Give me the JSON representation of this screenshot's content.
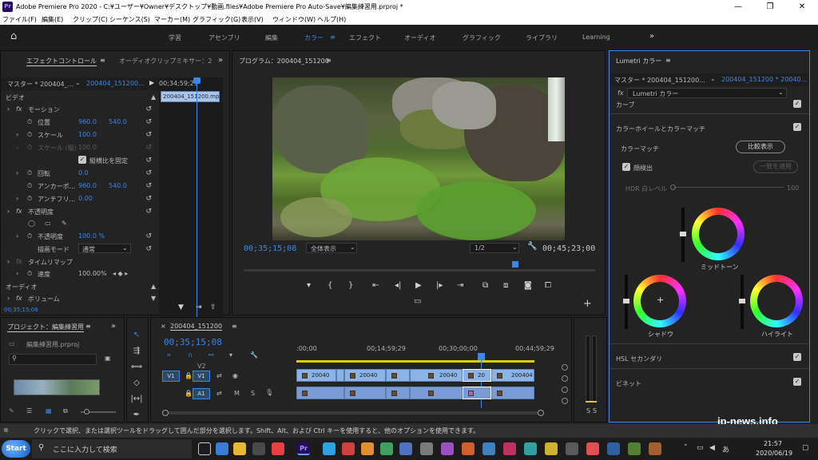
{
  "window": {
    "title": "Adobe Premiere Pro 2020 - C:¥ユーザー¥Owner¥デスクトップ¥動画.files¥Adobe Premiere Pro Auto-Save¥編集練習用.prproj *",
    "logo": "Pr",
    "minimize_icon": "minimize-icon",
    "restore_icon": "restore-icon",
    "close_icon": "close-icon"
  },
  "menu": [
    "ファイル(F)",
    "編集(E)",
    "クリップ(C)",
    "シーケンス(S)",
    "マーカー(M)",
    "グラフィック(G)",
    "表示(V)",
    "ウィンドウ(W)",
    "ヘルプ(H)"
  ],
  "workspaces": {
    "items": [
      "学習",
      "アセンブリ",
      "編集",
      "カラー",
      "エフェクト",
      "オーディオ",
      "グラフィック",
      "ライブラリ",
      "Learning"
    ],
    "active": "カラー",
    "more": "»"
  },
  "effect_controls": {
    "tab": "エフェクトコントロール",
    "tab_menu": "≡",
    "tab2": "オーディオクリップミキサー：2",
    "more": "»",
    "master": "マスター * 200404_...",
    "clip": "200404_151200...",
    "mini_timecode": "00;34;59;29",
    "mini_clip": "200404_151200.mp",
    "section_video": "ビデオ",
    "motion": "モーション",
    "position_label": "位置",
    "position_x": "960.0",
    "position_y": "540.0",
    "scale_label": "スケール",
    "scale_value": "100.0",
    "scale_w_label": "スケール (幅)",
    "scale_w_value": "100.0",
    "uniform_scale": "縦横比を固定",
    "rotation_label": "回転",
    "rotation_value": "0.0",
    "anchor_label": "アンカーポ...",
    "anchor_x": "960.0",
    "anchor_y": "540.0",
    "antiflicker_label": "アンチフリ...",
    "antiflicker_value": "0.00",
    "opacity": "不透明度",
    "opacity_label": "不透明度",
    "opacity_value": "100.0 %",
    "blend_label": "描画モード",
    "blend_value": "通常",
    "time_remap": "タイムリマップ",
    "speed_label": "速度",
    "speed_value": "100.00%",
    "section_audio": "オーディオ",
    "volume": "ボリューム",
    "footer_tc": "00;35;15;08"
  },
  "program": {
    "title": "プログラム：200404_151200",
    "menu": "≡",
    "current_tc": "00;35;15;08",
    "fit": "全体表示",
    "resolution": "1/2",
    "duration_tc": "00;45;23;00"
  },
  "project": {
    "tab": "プロジェクト：編集練習用",
    "menu": "≡",
    "more": "»",
    "file": "編集練習用.prproj"
  },
  "timeline": {
    "tab": "200404_151200",
    "tab_menu": "≡",
    "close": "×",
    "current_tc": "00;35;15;08",
    "ruler": [
      ":00;00",
      "00;14;59;29",
      "00;30;00;00",
      "00;44;59;29"
    ],
    "tracks_video": [
      {
        "src": "V1",
        "name": "V1"
      },
      {
        "name": "V2"
      }
    ],
    "tracks_audio": [
      {
        "name": "A1",
        "m": "M",
        "s": "S"
      }
    ],
    "clips": [
      "20040",
      "20040",
      "20040",
      "20",
      "200404"
    ],
    "audio_meter": [
      "S",
      "S"
    ]
  },
  "lumetri": {
    "title": "Lumetri カラー",
    "menu": "≡",
    "master": "マスター * 200404_151200...",
    "clip": "200404_151200 * 20040...",
    "fx_label": "fx",
    "effect": "Lumetri カラー",
    "curves": "カーブ",
    "wheels_section": "カラーホイールとカラーマッチ",
    "color_match": "カラーマッチ",
    "compare": "比較表示",
    "face_detect": "顔検出",
    "apply_match": "一致を適用",
    "hdr_label": "HDR 白レベル",
    "hdr_value": "100",
    "midtones": "ミッドトーン",
    "shadows": "シャドウ",
    "highlights": "ハイライト",
    "hsl": "HSL セカンダリ",
    "vignette": "ビネット"
  },
  "status_bar": "クリックで選択、または選択ツールをドラッグして囲んだ部分を選択します。Shift、Alt、および Ctrl キーを使用すると、他のオプションを使用できます。",
  "watermark": "jp-news.info",
  "taskbar": {
    "start": "Start",
    "search": "ここに入力して検索",
    "time": "21:57",
    "date": "2020/06/19",
    "lang": "あ",
    "pr_icon": "Pr"
  },
  "colors": {
    "accent": "#3b86e8",
    "panel": "#232323",
    "clip": "#8ab4e6"
  }
}
